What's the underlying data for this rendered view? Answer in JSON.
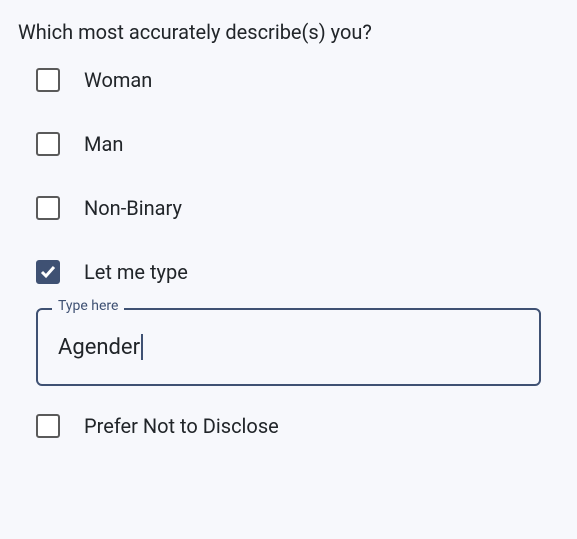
{
  "question": "Which most accurately describe(s) you?",
  "options": [
    {
      "label": "Woman",
      "checked": false
    },
    {
      "label": "Man",
      "checked": false
    },
    {
      "label": "Non-Binary",
      "checked": false
    },
    {
      "label": "Let me type",
      "checked": true
    },
    {
      "label": "Prefer Not to Disclose",
      "checked": false
    }
  ],
  "typeInput": {
    "legend": "Type here",
    "value": "Agender"
  },
  "colors": {
    "accent": "#3f5173",
    "background": "#f7f8fc"
  }
}
